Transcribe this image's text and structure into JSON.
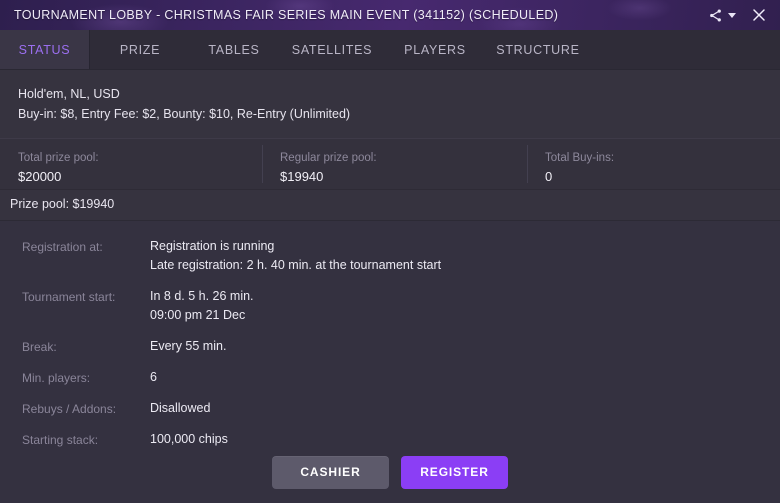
{
  "titlebar": {
    "title": "TOURNAMENT LOBBY - CHRISTMAS FAIR SERIES MAIN EVENT (341152) (SCHEDULED)",
    "share_icon": "share-icon",
    "dropdown_icon": "chevron-down-icon",
    "close_icon": "close-icon",
    "gradient_from": "#2e1f4e",
    "gradient_to": "#47296f"
  },
  "tabs": [
    {
      "id": "status",
      "label": "STATUS",
      "active": true
    },
    {
      "id": "prize",
      "label": "PRIZE",
      "active": false
    },
    {
      "id": "tables",
      "label": "TABLES",
      "active": false
    },
    {
      "id": "satellites",
      "label": "SATELLITES",
      "active": false
    },
    {
      "id": "players",
      "label": "PLAYERS",
      "active": false
    },
    {
      "id": "structure",
      "label": "STRUCTURE",
      "active": false
    }
  ],
  "game_info": {
    "line1": "Hold'em, NL, USD",
    "line2": "Buy-in: $8, Entry Fee: $2, Bounty: $10, Re-Entry (Unlimited)"
  },
  "stats": [
    {
      "label": "Total prize pool:",
      "value": "$20000"
    },
    {
      "label": "Regular prize pool:",
      "value": "$19940"
    },
    {
      "label": "Total Buy-ins:",
      "value": "0"
    }
  ],
  "prize_strip": {
    "text": "Prize pool: $19940"
  },
  "details": [
    {
      "label": "Registration at:",
      "values": [
        "Registration is running",
        "Late registration: 2 h. 40 min. at the tournament start"
      ]
    },
    {
      "label": "Tournament start:",
      "values": [
        "In 8 d. 5 h. 26 min.",
        "09:00 pm 21 Dec"
      ]
    },
    {
      "label": "Break:",
      "values": [
        "Every 55 min."
      ]
    },
    {
      "label": "Min. players:",
      "values": [
        "6"
      ]
    },
    {
      "label": "Rebuys / Addons:",
      "values": [
        "Disallowed"
      ]
    },
    {
      "label": "Starting stack:",
      "values": [
        "100,000 chips"
      ]
    }
  ],
  "footer": {
    "cashier_label": "CASHIER",
    "register_label": "REGISTER",
    "register_color": "#8b3ef5",
    "cashier_color": "#5d5a6b"
  }
}
